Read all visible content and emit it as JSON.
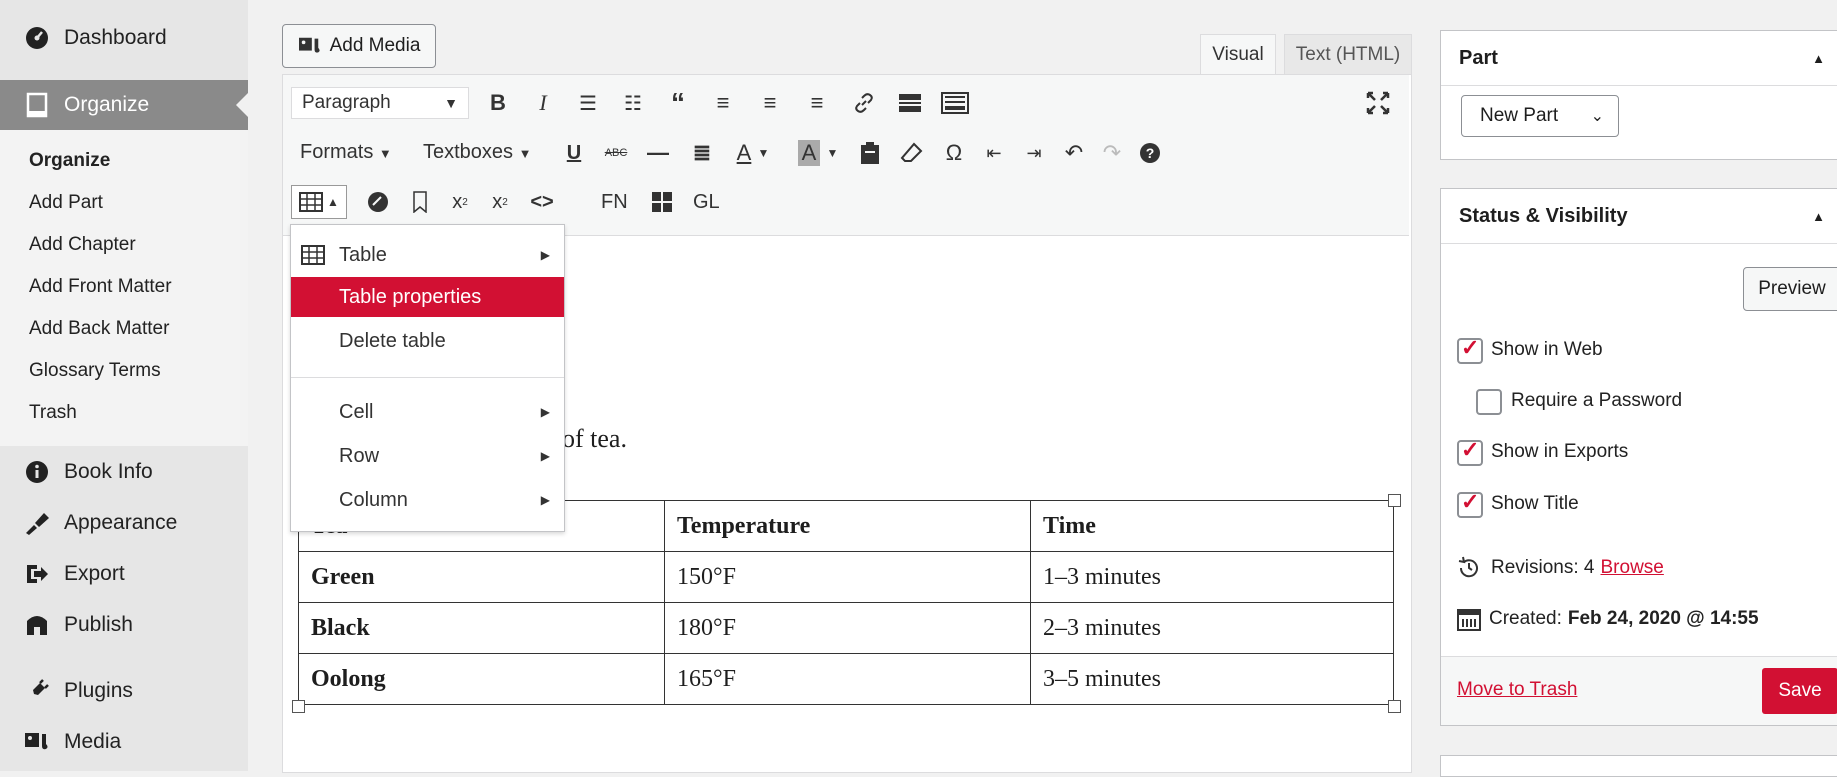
{
  "sidebar": {
    "top_items": [
      {
        "label": "Dashboard",
        "icon": "dashboard-icon"
      },
      {
        "label": "Organize",
        "icon": "book-icon",
        "active": true
      }
    ],
    "submenu": [
      "Organize",
      "Add Part",
      "Add Chapter",
      "Add Front Matter",
      "Add Back Matter",
      "Glossary Terms",
      "Trash"
    ],
    "bottom_items": [
      {
        "label": "Book Info",
        "icon": "info-icon"
      },
      {
        "label": "Appearance",
        "icon": "brush-icon"
      },
      {
        "label": "Export",
        "icon": "export-icon"
      },
      {
        "label": "Publish",
        "icon": "store-icon"
      },
      {
        "label": "Plugins",
        "icon": "plugin-icon"
      },
      {
        "label": "Media",
        "icon": "media-icon"
      }
    ]
  },
  "editor": {
    "add_media_label": "Add Media",
    "tabs": [
      "Visual",
      "Text (HTML)"
    ],
    "format_select": "Paragraph",
    "formats_label": "Formats",
    "textboxes_label": "Textboxes",
    "fn_label": "FN",
    "gl_label": "GL",
    "content_fragment": "of tea.",
    "table": {
      "header": [
        "Tea",
        "Temperature",
        "Time"
      ],
      "rows": [
        [
          "Green",
          "150°F",
          "1–3 minutes"
        ],
        [
          "Black",
          "180°F",
          "2–3 minutes"
        ],
        [
          "Oolong",
          "165°F",
          "3–5 minutes"
        ]
      ]
    }
  },
  "table_menu": {
    "items": [
      "Table",
      "Table properties",
      "Delete table",
      "Cell",
      "Row",
      "Column"
    ],
    "highlighted": "Table properties",
    "highlight_color": "#d21033"
  },
  "part_panel": {
    "title": "Part",
    "select_value": "New Part"
  },
  "status_panel": {
    "title": "Status & Visibility",
    "preview_label": "Preview",
    "options": [
      {
        "label": "Show in Web",
        "checked": true
      },
      {
        "label": "Require a Password",
        "checked": false
      },
      {
        "label": "Show in Exports",
        "checked": true
      },
      {
        "label": "Show Title",
        "checked": true
      }
    ],
    "revisions_label": "Revisions: 4",
    "browse_label": "Browse",
    "created_label": "Created:",
    "created_value": "Feb 24, 2020 @ 14:55",
    "trash_label": "Move to Trash",
    "save_label": "Save",
    "accent_color": "#d21033"
  }
}
